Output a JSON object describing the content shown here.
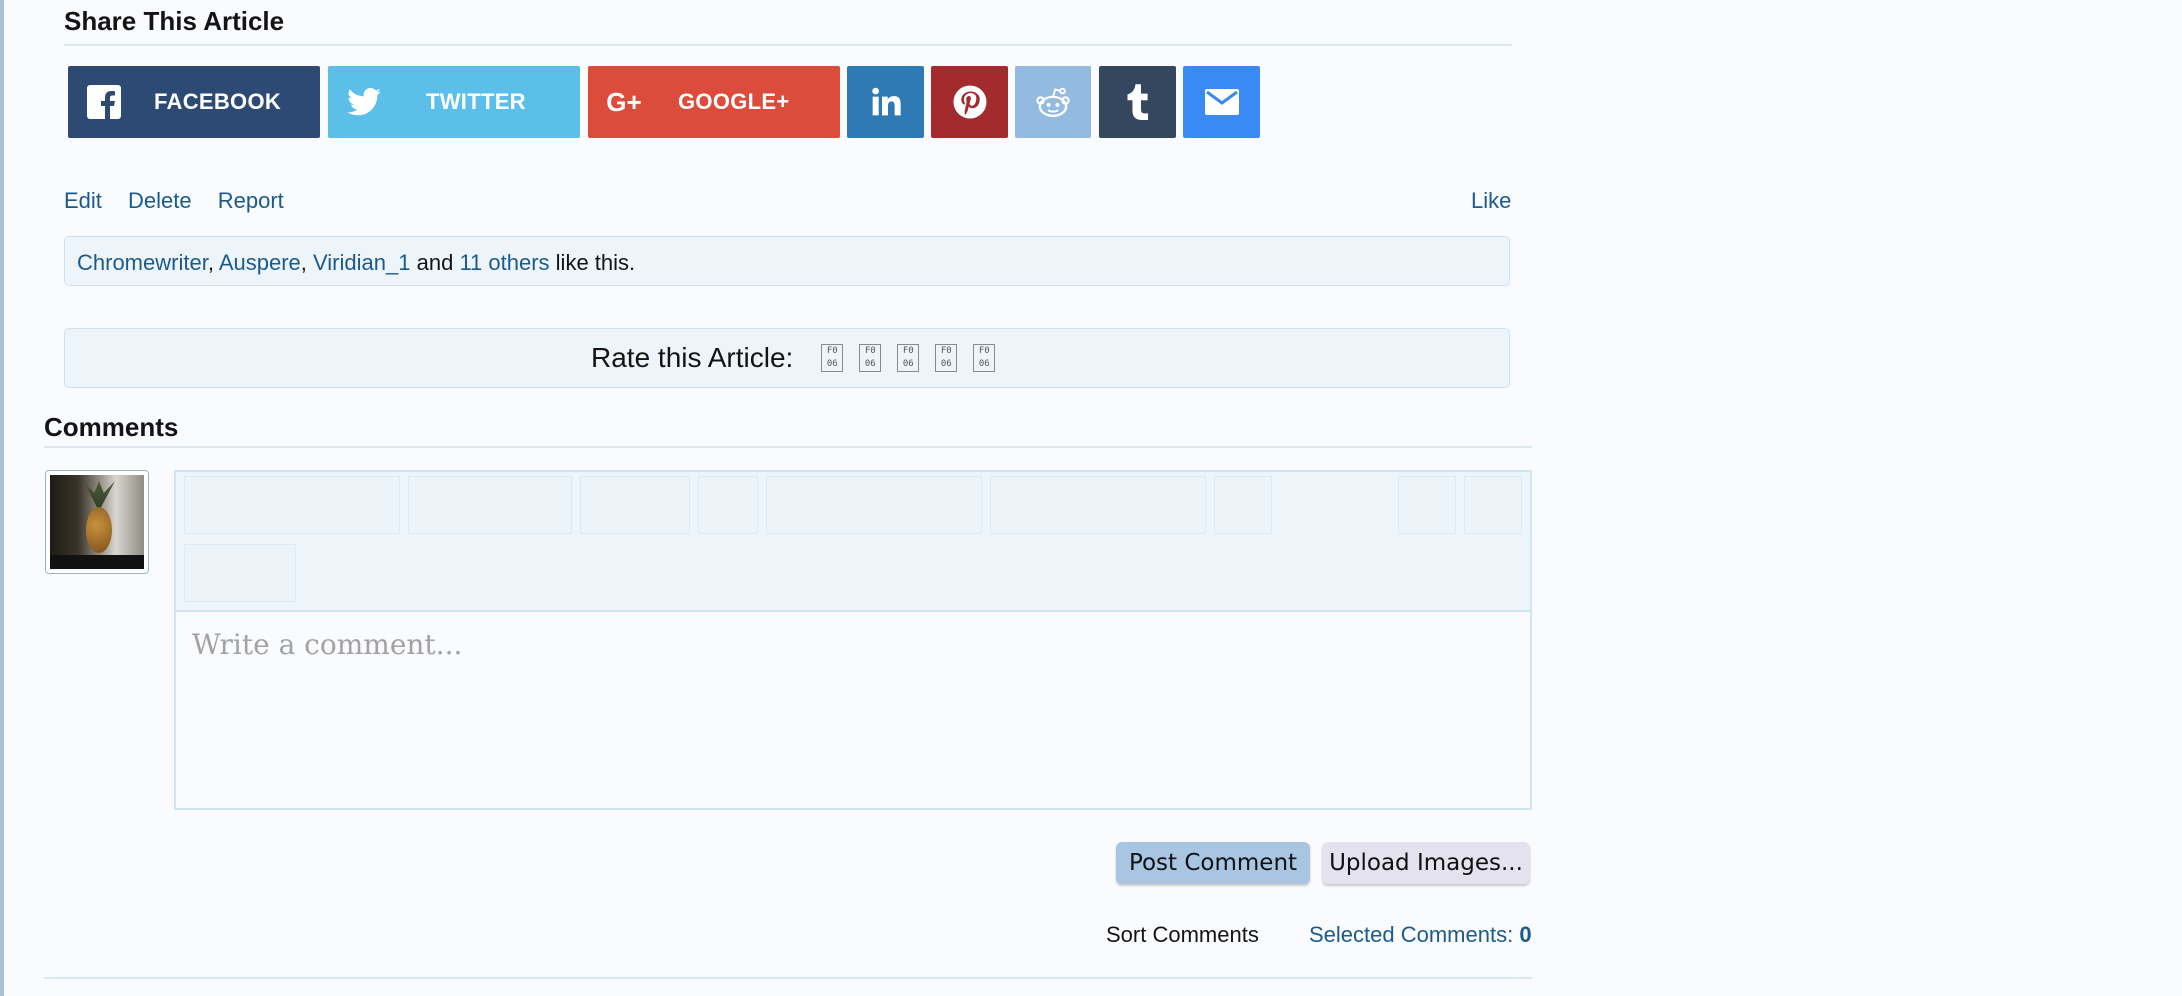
{
  "share": {
    "title": "Share This Article",
    "facebook": "FACEBOOK",
    "twitter": "TWITTER",
    "googleplus": "GOOGLE+",
    "gplus_glyph": "G+",
    "icons": [
      "facebook-icon",
      "twitter-icon",
      "googleplus-icon",
      "linkedin-icon",
      "pinterest-icon",
      "reddit-icon",
      "tumblr-icon",
      "email-icon"
    ],
    "colors": {
      "facebook": "#2d4a75",
      "twitter": "#5bbfe9",
      "googleplus": "#db4c3a",
      "linkedin": "#2f7ab5",
      "pinterest": "#a32a2d",
      "reddit": "#93bae0",
      "tumblr": "#35465f",
      "email": "#398af4"
    }
  },
  "actions": {
    "edit": "Edit",
    "delete": "Delete",
    "report": "Report",
    "like": "Like"
  },
  "likes": {
    "users": [
      "Chromewriter",
      "Auspere",
      "Viridian_1"
    ],
    "and": "and",
    "others": "11 others",
    "suffix": "like this."
  },
  "rating": {
    "label": "Rate this Article:",
    "star_glyph": "F0 06",
    "stars": 5
  },
  "comments": {
    "title": "Comments",
    "placeholder": "Write a comment...",
    "post_label": "Post Comment",
    "upload_label": "Upload Images...",
    "sort_label": "Sort Comments",
    "selected_label": "Selected Comments:",
    "selected_count": "0"
  }
}
